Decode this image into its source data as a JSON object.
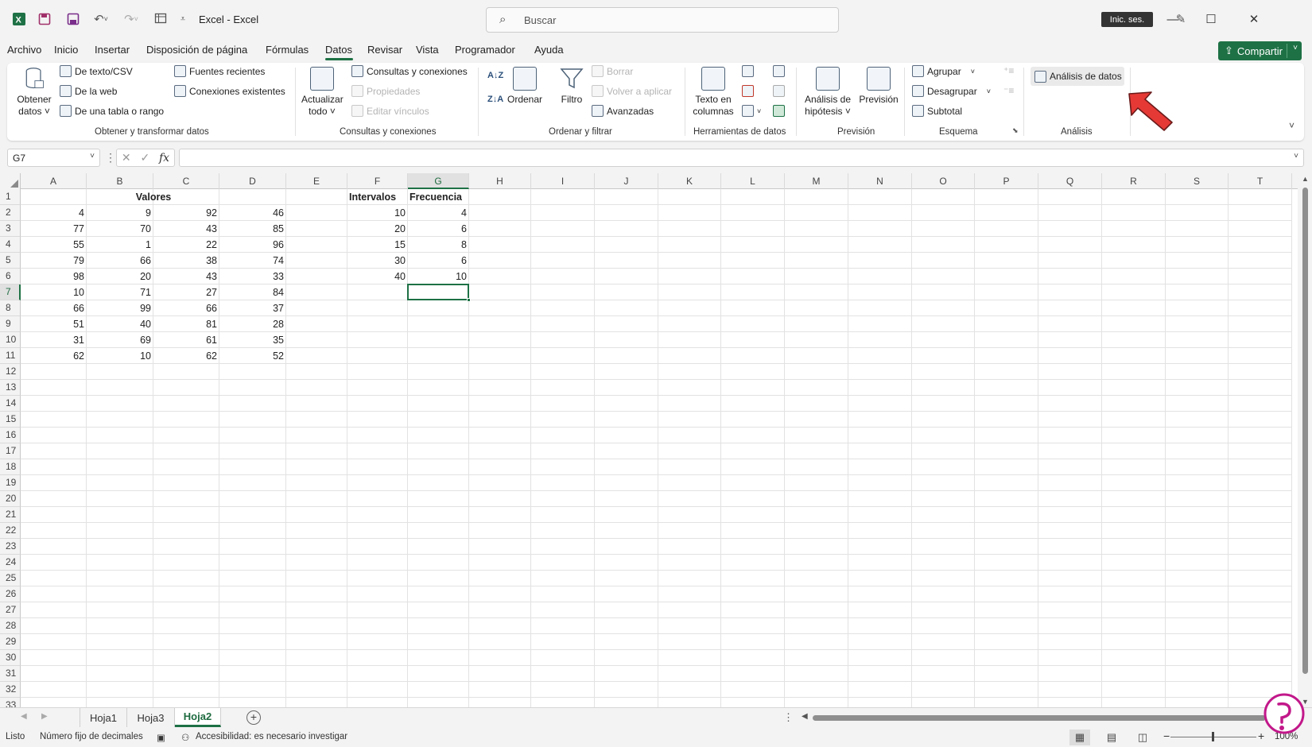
{
  "window": {
    "title": "Excel  -  Excel",
    "search_placeholder": "Buscar",
    "signin_label": "Inic. ses.",
    "minimize": "—",
    "maximize": "☐",
    "close": "✕"
  },
  "menu": {
    "tabs": [
      "Archivo",
      "Inicio",
      "Insertar",
      "Disposición de página",
      "Fórmulas",
      "Datos",
      "Revisar",
      "Vista",
      "Programador",
      "Ayuda"
    ],
    "active": "Datos",
    "share_label": "Compartir"
  },
  "ribbon": {
    "get_data": {
      "big_label_1": "Obtener",
      "big_label_2": "datos ˅",
      "text_csv": "De texto/CSV",
      "web": "De la web",
      "table_range": "De una tabla o rango",
      "recent_sources": "Fuentes recientes",
      "existing_connections": "Conexiones existentes",
      "group_label": "Obtener y transformar datos"
    },
    "queries": {
      "refresh_1": "Actualizar",
      "refresh_2": "todo ˅",
      "queries_connections": "Consultas y conexiones",
      "properties": "Propiedades",
      "edit_links": "Editar vínculos",
      "group_label": "Consultas y conexiones"
    },
    "sort_filter": {
      "sort_az": "A↓Z",
      "sort_za": "Z↓A",
      "sort": "Ordenar",
      "filter": "Filtro",
      "clear": "Borrar",
      "reapply": "Volver a aplicar",
      "advanced": "Avanzadas",
      "group_label": "Ordenar y filtrar"
    },
    "data_tools": {
      "text_to_columns_1": "Texto en",
      "text_to_columns_2": "columnas",
      "group_label": "Herramientas de datos"
    },
    "forecast": {
      "whatif_1": "Análisis de",
      "whatif_2": "hipótesis ˅",
      "forecast_sheet": "Previsión",
      "group_label": "Previsión"
    },
    "outline": {
      "group": "Agrupar",
      "ungroup": "Desagrupar",
      "subtotal": "Subtotal",
      "group_label": "Esquema"
    },
    "analysis": {
      "data_analysis": "Análisis de datos",
      "group_label": "Análisis"
    }
  },
  "formula_bar": {
    "name_box": "G7",
    "fx": "fx",
    "formula": ""
  },
  "sheet": {
    "columns": [
      "A",
      "B",
      "C",
      "D",
      "E",
      "F",
      "G",
      "H",
      "I",
      "J",
      "K",
      "L",
      "M",
      "N",
      "O",
      "P",
      "Q",
      "R",
      "S",
      "T"
    ],
    "selected_column": "G",
    "selected_row": 7,
    "rows": [
      "1",
      "2",
      "3",
      "4",
      "5",
      "6",
      "7",
      "8",
      "9",
      "10",
      "11",
      "12",
      "13",
      "14",
      "15",
      "16",
      "17",
      "18",
      "19",
      "20",
      "21",
      "22",
      "23",
      "24",
      "25",
      "26",
      "27",
      "28",
      "29",
      "30",
      "31",
      "32",
      "33"
    ],
    "header_valores": "Valores",
    "header_intervalos": "Intervalos",
    "header_frecuencia": "Frecuencia",
    "values_table": [
      [
        4,
        9,
        92,
        46
      ],
      [
        77,
        70,
        43,
        85
      ],
      [
        55,
        1,
        22,
        96
      ],
      [
        79,
        66,
        38,
        74
      ],
      [
        98,
        20,
        43,
        33
      ],
      [
        10,
        71,
        27,
        84
      ],
      [
        66,
        99,
        66,
        37
      ],
      [
        51,
        40,
        81,
        28
      ],
      [
        31,
        69,
        61,
        35
      ],
      [
        62,
        10,
        62,
        52
      ]
    ],
    "intervalos": [
      10,
      20,
      15,
      30,
      40
    ],
    "frecuencia": [
      4,
      6,
      8,
      6,
      10
    ]
  },
  "sheet_tabs": {
    "tabs": [
      "Hoja1",
      "Hoja3",
      "Hoja2"
    ],
    "active": "Hoja2",
    "add": "+"
  },
  "status": {
    "ready": "Listo",
    "fixed_decimal": "Número fijo de decimales",
    "accessibility": "Accesibilidad: es necesario investigar",
    "zoom": "100%"
  },
  "colors": {
    "accent": "#1e7145",
    "arrow": "#e53935"
  }
}
